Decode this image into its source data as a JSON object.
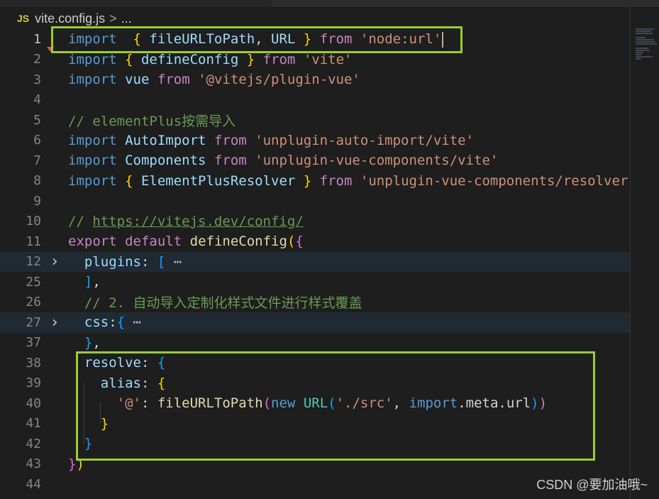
{
  "breadcrumb": {
    "file_icon": "JS",
    "file": "vite.config.js",
    "separator": ">",
    "more": "..."
  },
  "watermark": "CSDN @要加油哦~",
  "colors": {
    "highlight_box": "#9acd32",
    "background": "#1e1e1e"
  },
  "lines": [
    {
      "num": "1",
      "tokens": [
        [
          "k",
          "import"
        ],
        [
          "",
          "  "
        ],
        [
          "b1",
          "{"
        ],
        [
          "id",
          " fileURLToPath"
        ],
        [
          "",
          ", "
        ],
        [
          "id",
          "URL "
        ],
        [
          "b1",
          "}"
        ],
        [
          "",
          " "
        ],
        [
          "c",
          "from"
        ],
        [
          "",
          " "
        ],
        [
          "s",
          "'node:url'"
        ]
      ]
    },
    {
      "num": "2",
      "tokens": [
        [
          "k",
          "import"
        ],
        [
          "",
          " "
        ],
        [
          "b1",
          "{"
        ],
        [
          "id",
          " defineConfig "
        ],
        [
          "b1",
          "}"
        ],
        [
          "",
          " "
        ],
        [
          "c",
          "from"
        ],
        [
          "",
          " "
        ],
        [
          "s",
          "'vite'"
        ]
      ]
    },
    {
      "num": "3",
      "tokens": [
        [
          "k",
          "import"
        ],
        [
          "",
          " "
        ],
        [
          "id",
          "vue"
        ],
        [
          "",
          " "
        ],
        [
          "c",
          "from"
        ],
        [
          "",
          " "
        ],
        [
          "s",
          "'@vitejs/plugin-vue'"
        ]
      ]
    },
    {
      "num": "4",
      "tokens": []
    },
    {
      "num": "5",
      "tokens": [
        [
          "cm",
          "// elementPlus按需导入"
        ]
      ]
    },
    {
      "num": "6",
      "tokens": [
        [
          "k",
          "import"
        ],
        [
          "",
          " "
        ],
        [
          "id",
          "AutoImport"
        ],
        [
          "",
          " "
        ],
        [
          "c",
          "from"
        ],
        [
          "",
          " "
        ],
        [
          "s",
          "'unplugin-auto-import/vite'"
        ]
      ]
    },
    {
      "num": "7",
      "tokens": [
        [
          "k",
          "import"
        ],
        [
          "",
          " "
        ],
        [
          "id",
          "Components"
        ],
        [
          "",
          " "
        ],
        [
          "c",
          "from"
        ],
        [
          "",
          " "
        ],
        [
          "s",
          "'unplugin-vue-components/vite'"
        ]
      ]
    },
    {
      "num": "8",
      "tokens": [
        [
          "k",
          "import"
        ],
        [
          "",
          " "
        ],
        [
          "b1",
          "{"
        ],
        [
          "id",
          " ElementPlusResolver "
        ],
        [
          "b1",
          "}"
        ],
        [
          "",
          " "
        ],
        [
          "c",
          "from"
        ],
        [
          "",
          " "
        ],
        [
          "s",
          "'unplugin-vue-components/resolver"
        ]
      ]
    },
    {
      "num": "9",
      "tokens": []
    },
    {
      "num": "10",
      "tokens": [
        [
          "cm",
          "// "
        ],
        [
          "cm link",
          "https://vitejs.dev/config/"
        ]
      ]
    },
    {
      "num": "11",
      "tokens": [
        [
          "c",
          "export"
        ],
        [
          "",
          " "
        ],
        [
          "c",
          "default"
        ],
        [
          "",
          " "
        ],
        [
          "fn",
          "defineConfig"
        ],
        [
          "b1",
          "("
        ],
        [
          "b2",
          "{"
        ]
      ]
    },
    {
      "num": "12",
      "tokens": [
        [
          "",
          ""
        ],
        [
          "id",
          "  plugins"
        ],
        [
          "",
          ": "
        ],
        [
          "b3",
          "["
        ],
        [
          "ell",
          " ⋯"
        ]
      ]
    },
    {
      "num": "25",
      "tokens": [
        [
          "",
          "  "
        ],
        [
          "b3",
          "]"
        ],
        [
          "",
          ","
        ]
      ]
    },
    {
      "num": "26",
      "tokens": [
        [
          "cm",
          "  // 2. 自动导入定制化样式文件进行样式覆盖"
        ]
      ]
    },
    {
      "num": "27",
      "tokens": [
        [
          "id",
          "  css"
        ],
        [
          "",
          ":"
        ],
        [
          "b3",
          "{"
        ],
        [
          "ell",
          " ⋯"
        ]
      ]
    },
    {
      "num": "37",
      "tokens": [
        [
          "",
          "  "
        ],
        [
          "b3",
          "}"
        ],
        [
          "",
          ","
        ]
      ]
    },
    {
      "num": "38",
      "tokens": [
        [
          "id",
          "  resolve"
        ],
        [
          "",
          ": "
        ],
        [
          "b3",
          "{"
        ]
      ]
    },
    {
      "num": "39",
      "tokens": [
        [
          "id",
          "    alias"
        ],
        [
          "",
          ": "
        ],
        [
          "b1",
          "{"
        ]
      ]
    },
    {
      "num": "40",
      "tokens": [
        [
          "",
          "      "
        ],
        [
          "s",
          "'@'"
        ],
        [
          "",
          ": "
        ],
        [
          "fn",
          "fileURLToPath"
        ],
        [
          "b2",
          "("
        ],
        [
          "k",
          "new"
        ],
        [
          "",
          " "
        ],
        [
          "cls",
          "URL"
        ],
        [
          "b3",
          "("
        ],
        [
          "s",
          "'./src'"
        ],
        [
          "",
          ", "
        ],
        [
          "k",
          "import"
        ],
        [
          "",
          ".meta.url"
        ],
        [
          "b3",
          ")"
        ],
        [
          "b2",
          ")"
        ]
      ]
    },
    {
      "num": "41",
      "tokens": [
        [
          "",
          "    "
        ],
        [
          "b1",
          "}"
        ]
      ]
    },
    {
      "num": "42",
      "tokens": [
        [
          "",
          "  "
        ],
        [
          "b3",
          "}"
        ]
      ]
    },
    {
      "num": "43",
      "tokens": [
        [
          "b2",
          "}"
        ],
        [
          "b1",
          ")"
        ]
      ]
    },
    {
      "num": "44",
      "tokens": []
    }
  ]
}
